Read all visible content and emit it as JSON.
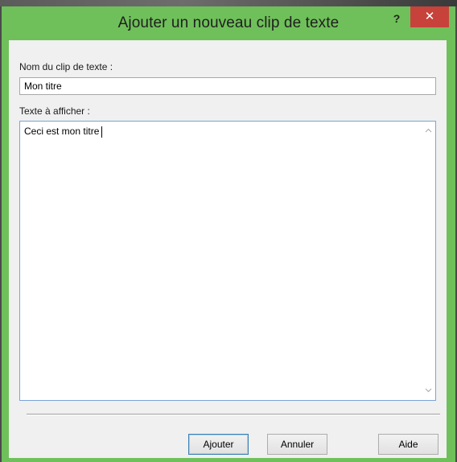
{
  "window": {
    "title": "Ajouter un nouveau clip de texte",
    "help_label": "?",
    "close_label": "✕"
  },
  "form": {
    "name_label": "Nom du clip de texte :",
    "name_value": "Mon titre",
    "text_label": "Texte à afficher :",
    "text_value": "Ceci est mon titre"
  },
  "buttons": {
    "add": "Ajouter",
    "cancel": "Annuler",
    "help": "Aide"
  },
  "icons": {
    "scroll_up": "chevron-up-icon",
    "scroll_down": "chevron-down-icon"
  },
  "colors": {
    "titlebar": "#6fc05a",
    "close": "#c7423a",
    "focus_border": "#7aa4d6"
  }
}
